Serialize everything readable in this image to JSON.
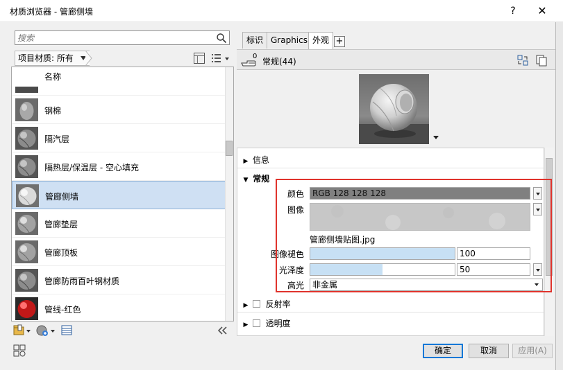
{
  "window": {
    "title": "材质浏览器 - 管廊侧墙",
    "help_label": "?",
    "close_label": "✕"
  },
  "search": {
    "placeholder": "搜索"
  },
  "library_filter": {
    "label": "项目材质: 所有"
  },
  "materials": [
    {
      "label": "名称",
      "thumb": "header"
    },
    {
      "label": "钢棉",
      "thumb": "egg"
    },
    {
      "label": "隔汽层",
      "thumb": "sphere-dark"
    },
    {
      "label": "隔热层/保温层 - 空心填充",
      "thumb": "sphere-dark"
    },
    {
      "label": "管廊侧墙",
      "thumb": "sphere-light",
      "selected": true
    },
    {
      "label": "管廊垫层",
      "thumb": "sphere-mid"
    },
    {
      "label": "管廊顶板",
      "thumb": "sphere-mid"
    },
    {
      "label": "管廊防雨百叶钢材质",
      "thumb": "sphere-dark"
    },
    {
      "label": "管线-红色",
      "thumb": "sphere-red"
    }
  ],
  "tabs": [
    {
      "label": "标识"
    },
    {
      "label": "Graphics"
    },
    {
      "label": "外观",
      "active": true
    }
  ],
  "tab_add_label": "+",
  "asset": {
    "user_count": "0",
    "name": "常规(44)"
  },
  "sections": {
    "info": "信息",
    "general": "常规",
    "reflectivity": "反射率",
    "transparency": "透明度"
  },
  "properties": {
    "color_label": "颜色",
    "color_value": "RGB 128 128 128",
    "image_label": "图像",
    "image_file": "管廊侧墙贴图.jpg",
    "fade_label": "图像褪色",
    "fade_value": "100",
    "fade_fraction": 1.0,
    "gloss_label": "光泽度",
    "gloss_value": "50",
    "gloss_fraction": 0.5,
    "highlight_label": "高光",
    "highlight_value": "非金属"
  },
  "buttons": {
    "ok": "确定",
    "cancel": "取消",
    "apply": "应用(A)"
  },
  "colors": {
    "selection": "#cfe0f3",
    "accent": "#0078d7",
    "annotation_red": "#e0332c",
    "slider_fill": "#c7e0f4",
    "color_swatch": "#808080"
  }
}
